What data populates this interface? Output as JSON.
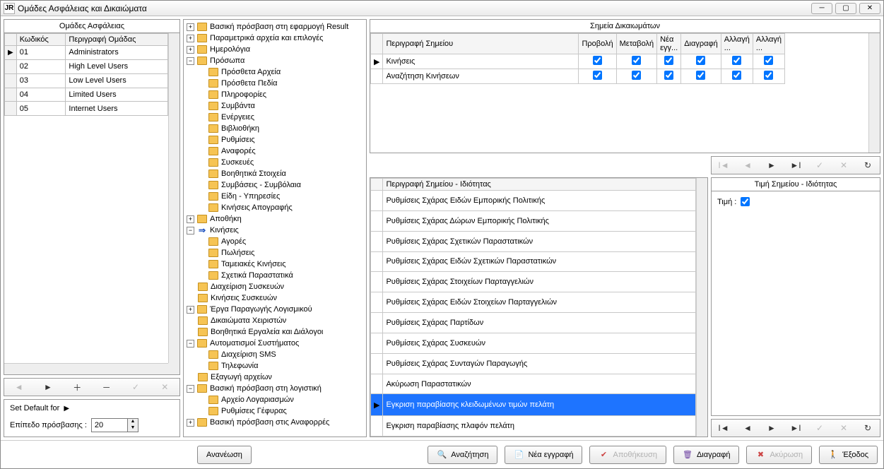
{
  "window": {
    "title": "Ομάδες Ασφάλειας και Δικαιώματα",
    "app_icon_text": "JR"
  },
  "groups_panel": {
    "title": "Ομάδες Ασφάλειας",
    "col_code": "Κωδικός",
    "col_desc": "Περιγραφή Ομάδας",
    "rows": [
      {
        "code": "01",
        "desc": "Administrators"
      },
      {
        "code": "02",
        "desc": "High Level Users"
      },
      {
        "code": "03",
        "desc": "Low Level Users"
      },
      {
        "code": "04",
        "desc": "Limited Users"
      },
      {
        "code": "05",
        "desc": "Internet Users"
      }
    ]
  },
  "defaults": {
    "set_default_label": "Set Default for",
    "level_label": "Επίπεδο πρόσβασης :",
    "level_value": "20"
  },
  "tree": {
    "n0": "Βασική πρόσβαση στη εφαρμογή Result",
    "n1": "Παραμετρικά αρχεία και επιλογές",
    "n2": "Ημερολόγια",
    "n3": "Πρόσωπα",
    "n3c": {
      "a": "Πρόσθετα Αρχεία",
      "b": "Πρόσθετα Πεδία",
      "c": "Πληροφορίες",
      "d": "Συμβάντα",
      "e": "Ενέργειες",
      "f": "Βιβλιοθήκη",
      "g": "Ρυθμίσεις",
      "h": "Αναφορές",
      "i": "Συσκευές",
      "j": "Βοηθητικά Στοιχεία",
      "k": "Συμβάσεις - Συμβόλαια",
      "l": "Είδη - Υπηρεσίες",
      "m": "Κινήσεις Απογραφής"
    },
    "n4": "Αποθήκη",
    "n5": "Κινήσεις",
    "n5c": {
      "a": "Αγορές",
      "b": "Πωλήσεις",
      "c": "Ταμειακές Κινήσεις",
      "d": "Σχετικά Παραστατικά"
    },
    "n6": "Διαχείριση Συσκευών",
    "n7": "Κινήσεις Συσκευών",
    "n8": "Έργα Παραγωγής Λογισμικού",
    "n9": "Δικαιώματα Χειριστών",
    "n10": "Βοηθητικά Εργαλεία και Διάλογοι",
    "n11": "Αυτοματισμοί Συστήματος",
    "n11c": {
      "a": "Διαχείριση SMS",
      "b": "Τηλεφωνία"
    },
    "n12": "Εξαγωγή αρχείων",
    "n13": "Βασική πρόσβαση στη λογιστική",
    "n13c": {
      "a": "Αρχείο Λογαριασμών",
      "b": "Ρυθμίσεις Γέφυρας"
    },
    "n14": "Βασική πρόσβαση στις Αναφορρές"
  },
  "points_panel": {
    "title": "Σημεία Δικαιωμάτων",
    "col_desc": "Περιγραφή Σημείου",
    "col_view": "Προβολή",
    "col_edit": "Μεταβολή",
    "col_new": "Νέα εγγ...",
    "col_del": "Διαγραφή",
    "col_chg1": "Αλλαγή ...",
    "col_chg2": "Αλλαγή ...",
    "rows": [
      {
        "desc": "Κινήσεις"
      },
      {
        "desc": "Αναζήτηση Κινήσεων"
      }
    ]
  },
  "prop_list": {
    "header": "Περιγραφή Σημείου - Ιδιότητας",
    "rows": [
      "Ρυθμίσεις Σχάρας Ειδών Εμπορικής Πολιτικής",
      "Ρυθμίσεις Σχάρας Δώρων Εμπορικής Πολιτικής",
      "Ρυθμίσεις Σχάρας Σχετικών Παραστατικών",
      "Ρυθμίσεις Σχάρας Ειδών Σχετικών Παραστατικών",
      "Ρυθμίσεις Σχάρας Στοιχείων Παρταγγελιών",
      "Ρυθμίσεις Σχάρας Ειδών Στοιχείων Παρταγγελιών",
      "Ρυθμίσεις Σχάρας Παρτίδων",
      "Ρυθμίσεις Σχάρας Συσκευών",
      "Ρυθμίσεις Σχάρας Συνταγών Παραγωγής",
      "Ακύρωση Παραστατικών",
      "Εγκριση παραβίασης κλειδωμένων τιμών πελάτη",
      "Εγκριση παραβίασης πλαφόν πελάτη"
    ],
    "selected_index": 10
  },
  "value_panel": {
    "title": "Τιμή Σημείου - Ιδιότητας",
    "label": "Τιμή :",
    "checked": true
  },
  "bottom": {
    "refresh": "Ανανέωση",
    "search": "Αναζήτηση",
    "new": "Νέα εγγραφή",
    "save": "Αποθήκευση",
    "delete": "Διαγραφή",
    "cancel": "Ακύρωση",
    "exit": "Έξοδος"
  }
}
